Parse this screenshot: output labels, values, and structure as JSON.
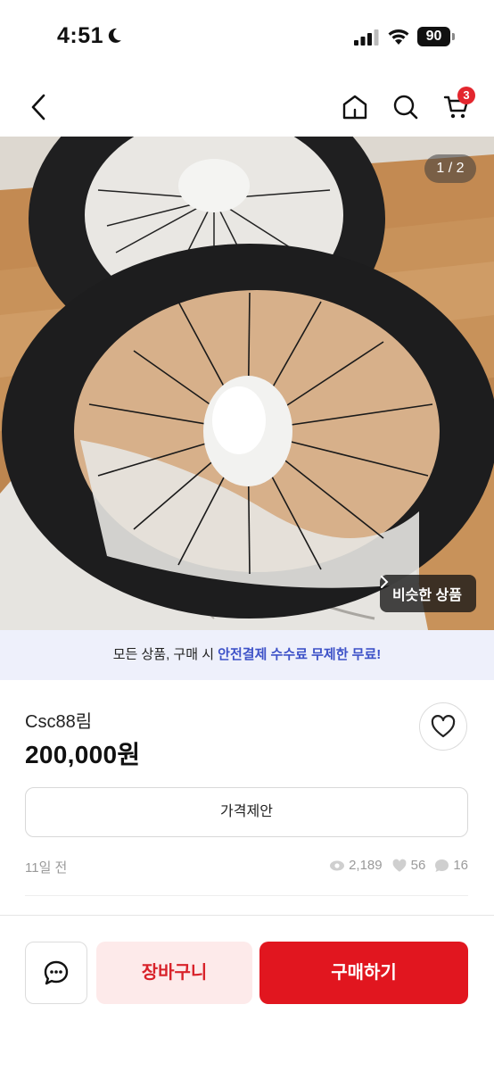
{
  "status_bar": {
    "time": "4:51",
    "battery": "90"
  },
  "nav": {
    "cart_badge": "3"
  },
  "gallery": {
    "page_counter": "1 / 2",
    "similar_label": "비슷한 상품"
  },
  "banner": {
    "prefix": "모든 상품, 구매 시 ",
    "highlight": "안전결제 수수료 무제한 무료!"
  },
  "product": {
    "title": "Csc88림",
    "price": "200,000원"
  },
  "offer_button": "가격제안",
  "meta": {
    "time_ago": "11일 전",
    "views": "2,189",
    "likes": "56",
    "chats": "16"
  },
  "bottom_bar": {
    "cart_label": "장바구니",
    "buy_label": "구매하기"
  },
  "colors": {
    "accent_red": "#e1161f",
    "banner_bg": "#eef0fb",
    "banner_highlight": "#3e52c8"
  },
  "icons": [
    "moon-icon",
    "signal-icon",
    "wifi-icon",
    "back-icon",
    "home-icon",
    "search-icon",
    "cart-icon",
    "chevron-right-icon",
    "heart-icon",
    "eye-icon",
    "chat-bubble-icon"
  ]
}
